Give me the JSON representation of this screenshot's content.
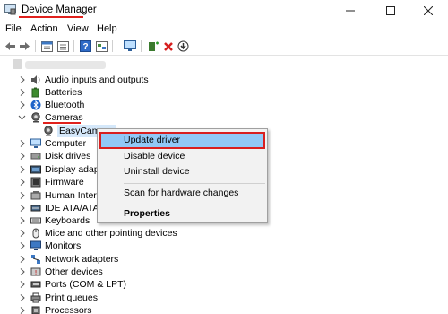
{
  "window": {
    "title": "Device Manager"
  },
  "menubar": {
    "items": [
      "File",
      "Action",
      "View",
      "Help"
    ]
  },
  "toolbar": {
    "buttons": [
      "back-arrow-icon",
      "forward-arrow-icon",
      "properties-icon",
      "list-icon",
      "help-icon",
      "tree-view-icon",
      "scan-monitor-icon",
      "add-driver-icon",
      "uninstall-icon",
      "download-icon"
    ]
  },
  "tree": {
    "items": [
      {
        "label": "Audio inputs and outputs",
        "icon": "speaker-icon",
        "expanded": false
      },
      {
        "label": "Batteries",
        "icon": "battery-icon",
        "expanded": false
      },
      {
        "label": "Bluetooth",
        "icon": "bluetooth-icon",
        "expanded": false
      },
      {
        "label": "Cameras",
        "icon": "camera-icon",
        "expanded": true
      },
      {
        "label": "Computer",
        "icon": "computer-icon",
        "expanded": false
      },
      {
        "label": "Disk drives",
        "icon": "disk-icon",
        "expanded": false
      },
      {
        "label": "Display adapte",
        "icon": "display-icon",
        "expanded": false
      },
      {
        "label": "Firmware",
        "icon": "firmware-icon",
        "expanded": false
      },
      {
        "label": "Human Interfa",
        "icon": "hid-icon",
        "expanded": false
      },
      {
        "label": "IDE ATA/ATAPI",
        "icon": "ide-icon",
        "expanded": false
      },
      {
        "label": "Keyboards",
        "icon": "keyboard-icon",
        "expanded": false
      },
      {
        "label": "Mice and other pointing devices",
        "icon": "mouse-icon",
        "expanded": false
      },
      {
        "label": "Monitors",
        "icon": "monitor-icon",
        "expanded": false
      },
      {
        "label": "Network adapters",
        "icon": "network-icon",
        "expanded": false
      },
      {
        "label": "Other devices",
        "icon": "other-device-icon",
        "expanded": false
      },
      {
        "label": "Ports (COM & LPT)",
        "icon": "port-icon",
        "expanded": false
      },
      {
        "label": "Print queues",
        "icon": "printer-icon",
        "expanded": false
      },
      {
        "label": "Processors",
        "icon": "processor-icon",
        "expanded": false
      }
    ],
    "camera_child": {
      "label": "EasyCamera",
      "icon": "webcam-icon"
    }
  },
  "context_menu": {
    "items": [
      {
        "label": "Update driver",
        "highlighted": true
      },
      {
        "label": "Disable device"
      },
      {
        "label": "Uninstall device"
      },
      {
        "label": "Scan for hardware changes"
      },
      {
        "label": "Properties",
        "bold": true
      }
    ]
  },
  "colors": {
    "annotation": "#e0211d",
    "hover": "#91c9f7",
    "selection": "#d5e8fa"
  }
}
